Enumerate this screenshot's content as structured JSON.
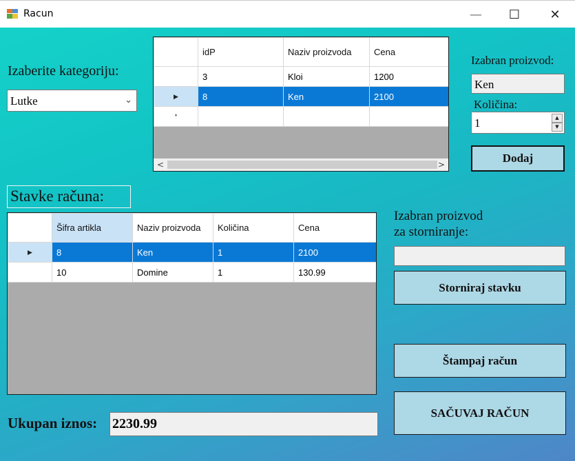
{
  "window": {
    "title": "Racun",
    "min_glyph": "—",
    "max_glyph": "☐",
    "close_glyph": "✕"
  },
  "category": {
    "label": "Izaberite kategoriju:",
    "selected": "Lutke",
    "chevron": "⌄"
  },
  "products_grid": {
    "columns": [
      "idP",
      "Naziv proizvoda",
      "Cena"
    ],
    "rows": [
      {
        "marker": "",
        "cells": [
          "3",
          "Kloi",
          "1200"
        ]
      },
      {
        "marker": "▶",
        "cells": [
          "8",
          "Ken",
          "2100"
        ]
      },
      {
        "marker": "*",
        "cells": [
          "",
          "",
          ""
        ]
      }
    ],
    "scroll_left": "<",
    "scroll_right": ">"
  },
  "selected_product": {
    "label": "Izabran proizvod:",
    "value": "Ken"
  },
  "quantity": {
    "label": "Količina:",
    "value": "1",
    "up": "▲",
    "down": "▼"
  },
  "add_button": "Dodaj",
  "items_title": "Stavke računa:",
  "items_grid": {
    "columns": [
      "Šifra artikla",
      "Naziv proizvoda",
      "Količina",
      "Cena"
    ],
    "rows": [
      {
        "marker": "▶",
        "cells": [
          "8",
          "Ken",
          "1",
          "2100"
        ]
      },
      {
        "marker": "",
        "cells": [
          "10",
          "Domine",
          "1",
          "130.99"
        ]
      }
    ]
  },
  "storno": {
    "label_line1": "Izabran proizvod",
    "label_line2": "za storniranje:",
    "value": "",
    "button": "Storniraj stavku"
  },
  "print_button": "Štampaj račun",
  "save_button": "SAČUVAJ RAČUN",
  "total": {
    "label": "Ukupan iznos:",
    "value": "2230.99"
  },
  "colors": {
    "button_bg": "#add8e6",
    "selection": "#0a79d6",
    "grid_bg": "#ababab"
  }
}
